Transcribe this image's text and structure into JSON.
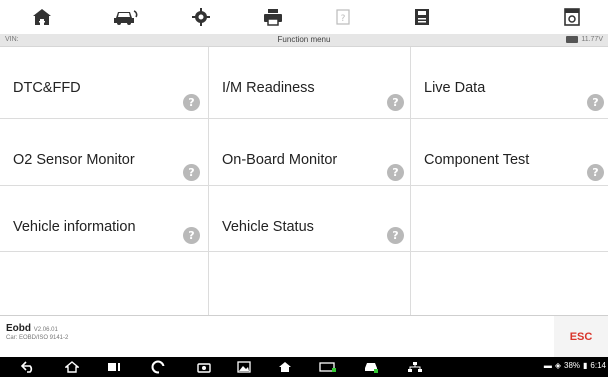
{
  "toolbar": {
    "icons": [
      "home-icon",
      "vehicle-swap-icon",
      "settings-icon",
      "print-icon",
      "help-icon",
      "save-icon",
      "screenshot-icon"
    ]
  },
  "status": {
    "vin_label": "VIN:",
    "title": "Function menu",
    "battery": "11.77V"
  },
  "menu": [
    {
      "label": "DTC&FFD"
    },
    {
      "label": "I/M Readiness"
    },
    {
      "label": "Live Data"
    },
    {
      "label": "O2 Sensor Monitor"
    },
    {
      "label": "On-Board Monitor"
    },
    {
      "label": "Component Test"
    },
    {
      "label": "Vehicle information"
    },
    {
      "label": "Vehicle Status"
    },
    {
      "label": ""
    }
  ],
  "help_glyph": "?",
  "footer": {
    "app": "Eobd",
    "version": "V2.06.01",
    "car": "Car: EOBD/ISO 9141-2",
    "esc": "ESC"
  },
  "navbar": {
    "icons": [
      "back-icon",
      "home-icon",
      "recent-apps-icon",
      "chrome-icon",
      "camera-icon",
      "gallery-icon",
      "app-home-icon",
      "vci-icon",
      "car-icon",
      "network-icon"
    ],
    "battery_percent": "38%",
    "time": "6:14"
  }
}
